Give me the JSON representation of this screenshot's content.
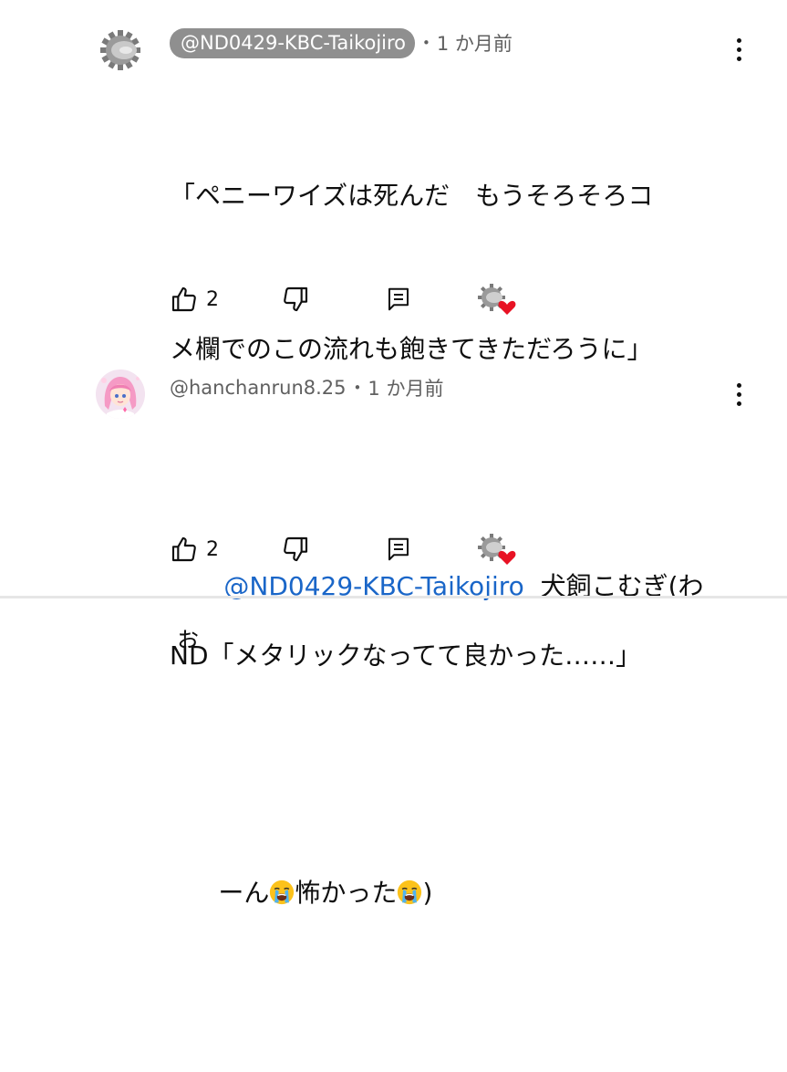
{
  "comments": [
    {
      "author": "@ND0429-KBC-Taikojiro",
      "author_style": "highlighted",
      "separator": "•",
      "age": "1 か月前",
      "text_lines": [
        "「ペニーワイズは死んだ　もうそろそろコ",
        "メ欄でのこの流れも飽きてきただろうに」",
        "",
        "ND「メタリックなってて良かった……」"
      ],
      "likes": "2",
      "avatar_icon": "gear-icon",
      "heart_badge_icon": "gear-heart-icon"
    },
    {
      "author": "@hanchanrun8.25",
      "separator": "•",
      "age": "1 か月前",
      "reply_mention": "@ND0429-KBC-Taikojiro",
      "reply_text_1": "犬飼こむぎ(わぉ",
      "reply_text_2a": "ーん",
      "reply_text_2b": "怖かった",
      "reply_text_2c": ")",
      "likes": "2",
      "avatar_icon": "anime-girl-avatar",
      "heart_badge_icon": "gear-heart-icon"
    }
  ],
  "icons": {
    "like": "thumb-up-icon",
    "dislike": "thumb-down-icon",
    "reply": "reply-icon",
    "menu": "more-vert-icon",
    "emoji": "loudly-crying-face-emoji"
  },
  "colors": {
    "pill_bg": "#8f8f8f",
    "mention": "#1a66c8",
    "heart": "#e81224",
    "text_secondary": "#606060"
  }
}
